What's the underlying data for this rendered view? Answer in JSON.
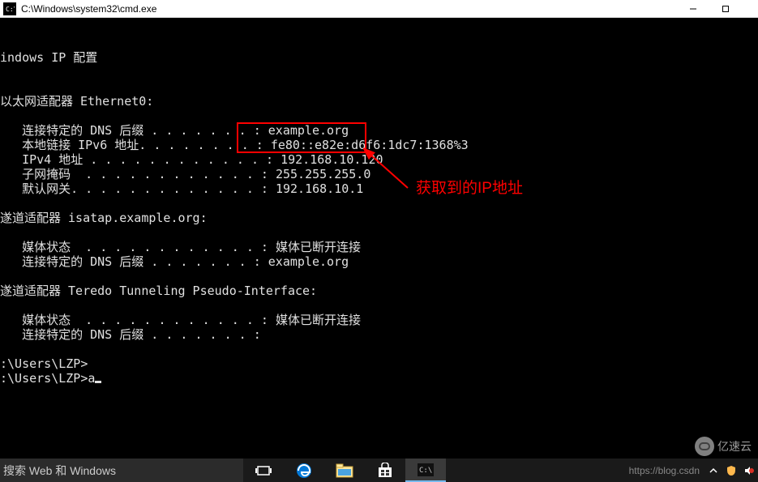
{
  "titlebar": {
    "title": "C:\\Windows\\system32\\cmd.exe"
  },
  "cmd": {
    "line_blank0": "",
    "line_ipconfig_header": "indows IP 配置",
    "line_blank1": "",
    "line_blank2": "",
    "line_eth_header": "以太网适配器 Ethernet0:",
    "line_blank3": "",
    "line_dns_suffix": "   连接特定的 DNS 后缀 . . . . . . . : example.org",
    "line_ipv6": "   本地链接 IPv6 地址. . . . . . . . : fe80::e82e:d6f6:1dc7:1368%3",
    "line_ipv4": "   IPv4 地址 . . . . . . . . . . . . : 192.168.10.120",
    "line_mask": "   子网掩码  . . . . . . . . . . . . : 255.255.255.0",
    "line_gateway": "   默认网关. . . . . . . . . . . . . : 192.168.10.1",
    "line_blank4": "",
    "line_isatap": "遂道适配器 isatap.example.org:",
    "line_blank5": "",
    "line_media1": "   媒体状态  . . . . . . . . . . . . : 媒体已断开连接",
    "line_dns2": "   连接特定的 DNS 后缀 . . . . . . . : example.org",
    "line_blank6": "",
    "line_teredo": "遂道适配器 Teredo Tunneling Pseudo-Interface:",
    "line_blank7": "",
    "line_media2": "   媒体状态  . . . . . . . . . . . . : 媒体已断开连接",
    "line_dns3": "   连接特定的 DNS 后缀 . . . . . . . :",
    "line_blank8": "",
    "line_prompt1": ":\\Users\\LZP>",
    "line_prompt2": ":\\Users\\LZP>a"
  },
  "annotation": {
    "label": "获取到的IP地址"
  },
  "taskbar": {
    "search_placeholder": "搜索 Web 和 Windows",
    "csdn": "https://blog.csdn"
  },
  "watermark": {
    "text": "亿速云"
  }
}
